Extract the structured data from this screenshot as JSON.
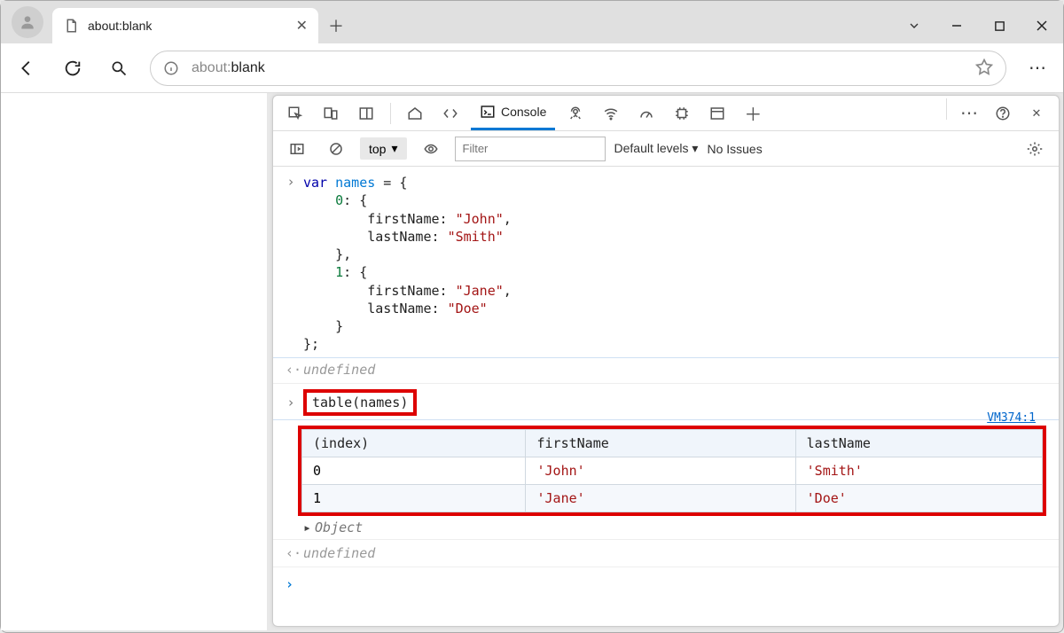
{
  "browser": {
    "tab_title": "about:blank",
    "address_prefix": "about:",
    "address_page": "blank"
  },
  "devtools": {
    "console_tab": "Console",
    "top": "top",
    "filter_placeholder": "Filter",
    "levels": "Default levels",
    "no_issues": "No Issues"
  },
  "console": {
    "code_lines": {
      "l0": "var names = {",
      "l1_num": "0",
      "l1_rest": ": {",
      "l2_k": "firstName:",
      "l2_v": "\"John\"",
      "l3_k": "lastName:",
      "l3_v": "\"Smith\"",
      "l4": "},",
      "l5_num": "1",
      "l5_rest": ": {",
      "l6_k": "firstName:",
      "l6_v": "\"Jane\"",
      "l7_k": "lastName:",
      "l7_v": "\"Doe\"",
      "l8": "}",
      "l9": "};"
    },
    "undefined1": "undefined",
    "call": "table(names)",
    "vm_ref": "VM374:1",
    "table": {
      "h0": "(index)",
      "h1": "firstName",
      "h2": "lastName",
      "rows": [
        {
          "index": "0",
          "first": "'John'",
          "last": "'Smith'"
        },
        {
          "index": "1",
          "first": "'Jane'",
          "last": "'Doe'"
        }
      ]
    },
    "object_label": "Object",
    "undefined2": "undefined"
  }
}
